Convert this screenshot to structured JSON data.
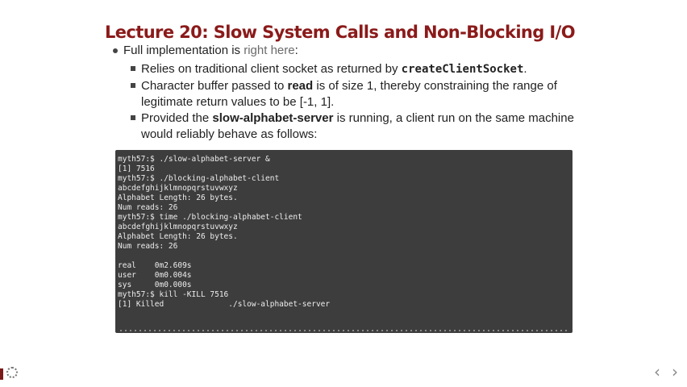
{
  "slide": {
    "title": "Lecture 20: Slow System Calls and Non-Blocking I/O",
    "bullet1": {
      "prefix": "Full implementation is ",
      "link": "right here",
      "suffix": ":"
    },
    "sub1": {
      "text": "Relies on traditional client socket as returned by ",
      "code": "createClientSocket",
      "end": "."
    },
    "sub2": {
      "a": "Character buffer passed to ",
      "bold": "read",
      "b": " is of size 1, thereby constraining the range of",
      "line2": "legitimate return values to be [-1, 1]."
    },
    "sub3": {
      "a": "Provided the ",
      "bold": "slow-alphabet-server",
      "b": " is running, a client run on the same machine",
      "line2": "would reliably behave as follows:"
    },
    "terminal": [
      "myth57:$ ./slow-alphabet-server &",
      "[1] 7516",
      "myth57:$ ./blocking-alphabet-client",
      "abcdefghijklmnopqrstuvwxyz",
      "Alphabet Length: 26 bytes.",
      "Num reads: 26",
      "myth57:$ time ./blocking-alphabet-client",
      "abcdefghijklmnopqrstuvwxyz",
      "Alphabet Length: 26 bytes.",
      "Num reads: 26",
      "",
      "real    0m2.609s",
      "user    0m0.004s",
      "sys     0m0.000s",
      "myth57:$ kill -KILL 7516",
      "[1] Killed              ./slow-alphabet-server"
    ],
    "nav": {
      "prev": "‹",
      "next": "›"
    }
  },
  "colors": {
    "title": "#8b1a1a",
    "terminal_bg": "#3d3d3d",
    "terminal_text": "#ededed",
    "link": "#6a6a6a"
  }
}
